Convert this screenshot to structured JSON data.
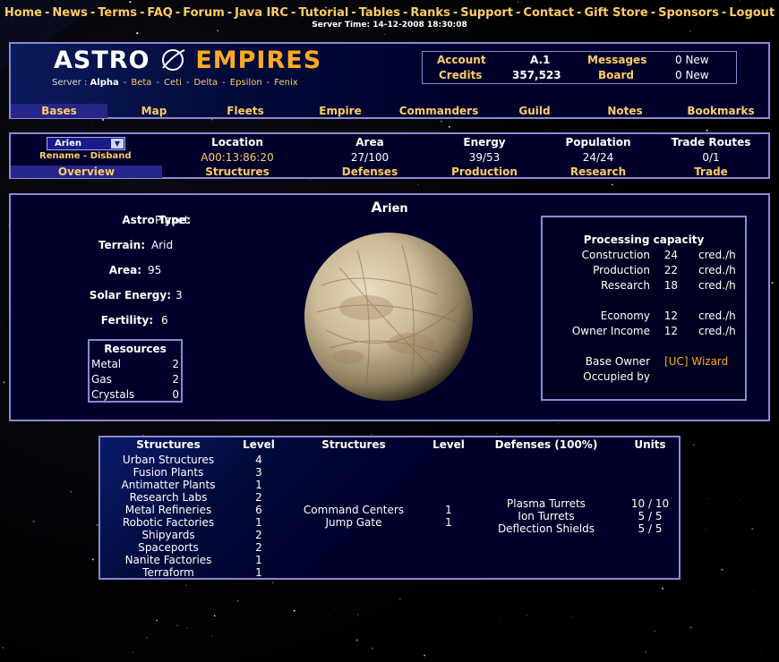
{
  "nav": {
    "items": [
      "Home",
      "News",
      "Terms",
      "FAQ",
      "Forum",
      "Java IRC",
      "Tutorial",
      "Tables",
      "Ranks",
      "Support",
      "Contact",
      "Gift Store",
      "Sponsors",
      "Logout"
    ],
    "server_time": "Server Time: 14-12-2008 18:30:08"
  },
  "logo": {
    "part1": "ASTRO",
    "part2": "EMPIRES"
  },
  "servers": {
    "label": "Server :",
    "current": "Alpha",
    "others": [
      "Beta",
      "Ceti",
      "Delta",
      "Epsilon",
      "Fenix"
    ]
  },
  "account": {
    "account_label": "Account",
    "account_value": "A.1",
    "credits_label": "Credits",
    "credits_value": "357,523",
    "messages_label": "Messages",
    "messages_value": "0 New",
    "board_label": "Board",
    "board_value": "0 New"
  },
  "main_menu": [
    "Bases",
    "Map",
    "Fleets",
    "Empire",
    "Commanders",
    "Guild",
    "Notes",
    "Bookmarks"
  ],
  "base_bar": {
    "selected_base": "Arien",
    "rename": "Rename",
    "dash": " - ",
    "disband": "Disband",
    "columns": [
      {
        "label": "Location",
        "value": "A00:13:86:20"
      },
      {
        "label": "Area",
        "value": "27/100"
      },
      {
        "label": "Energy",
        "value": "39/53"
      },
      {
        "label": "Population",
        "value": "24/24"
      },
      {
        "label": "Trade Routes",
        "value": "0/1"
      }
    ],
    "tabs": [
      "Overview",
      "Structures",
      "Defenses",
      "Production",
      "Research",
      "Trade"
    ]
  },
  "planet": {
    "name_first": "A",
    "name_rest": "rien",
    "attributes": [
      {
        "label": "Astro Type:",
        "value": "Planet"
      },
      {
        "label": "Terrain:",
        "value": "Arid"
      },
      {
        "label": "Area:",
        "value": "95"
      },
      {
        "label": "Solar Energy:",
        "value": "3"
      },
      {
        "label": "Fertility:",
        "value": "6"
      }
    ],
    "resources_title": "Resources",
    "resources": [
      {
        "name": "Metal",
        "value": "2"
      },
      {
        "name": "Gas",
        "value": "2"
      },
      {
        "name": "Crystals",
        "value": "0"
      }
    ]
  },
  "processing": {
    "title": "Processing capacity",
    "rows": [
      {
        "label": "Construction",
        "value": "24",
        "unit": "cred./h"
      },
      {
        "label": "Production",
        "value": "22",
        "unit": "cred./h"
      },
      {
        "label": "Research",
        "value": "18",
        "unit": "cred./h"
      },
      {
        "label": "Economy",
        "value": "12",
        "unit": "cred./h"
      },
      {
        "label": "Owner Income",
        "value": "12",
        "unit": "cred./h"
      }
    ],
    "base_owner_label": "Base Owner",
    "base_owner_value": "[UC] Wizard",
    "occupied_by_label": "Occupied by"
  },
  "structures": {
    "headers": [
      "Structures",
      "Level",
      "Structures",
      "Level",
      "Defenses (100%)",
      "Units"
    ],
    "list1": [
      {
        "name": "Urban Structures",
        "level": "4"
      },
      {
        "name": "Fusion Plants",
        "level": "3"
      },
      {
        "name": "Antimatter Plants",
        "level": "1"
      },
      {
        "name": "Research Labs",
        "level": "2"
      },
      {
        "name": "Metal Refineries",
        "level": "6"
      },
      {
        "name": "Robotic Factories",
        "level": "1"
      },
      {
        "name": "Shipyards",
        "level": "2"
      },
      {
        "name": "Spaceports",
        "level": "2"
      },
      {
        "name": "Nanite Factories",
        "level": "1"
      },
      {
        "name": "Terraform",
        "level": "1"
      }
    ],
    "list2": [
      {
        "name": "Command Centers",
        "level": "1"
      },
      {
        "name": "Jump Gate",
        "level": "1"
      }
    ],
    "defenses": [
      {
        "name": "Plasma Turrets",
        "units": "10 / 10"
      },
      {
        "name": "Ion Turrets",
        "units": "5 / 5"
      },
      {
        "name": "Deflection Shields",
        "units": "5 / 5"
      }
    ]
  }
}
